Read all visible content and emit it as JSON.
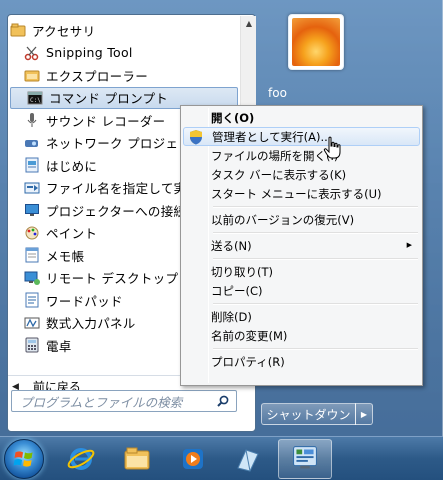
{
  "start_menu": {
    "programs": [
      {
        "label": "アクセサリ",
        "icon": "folder-icon",
        "folder": true
      },
      {
        "label": "Snipping Tool",
        "icon": "scissors-icon"
      },
      {
        "label": "エクスプローラー",
        "icon": "explorer-icon"
      },
      {
        "label": "コマンド プロンプト",
        "icon": "cmd-icon",
        "selected": true
      },
      {
        "label": "サウンド レコーダー",
        "icon": "microphone-icon"
      },
      {
        "label": "ネットワーク プロジェ",
        "icon": "network-projector-icon"
      },
      {
        "label": "はじめに",
        "icon": "getting-started-icon"
      },
      {
        "label": "ファイル名を指定して実",
        "icon": "run-icon"
      },
      {
        "label": "プロジェクターへの接続",
        "icon": "projector-icon"
      },
      {
        "label": "ペイント",
        "icon": "paint-icon"
      },
      {
        "label": "メモ帳",
        "icon": "notepad-icon"
      },
      {
        "label": "リモート デスクトップ",
        "icon": "remote-desktop-icon"
      },
      {
        "label": "ワードパッド",
        "icon": "wordpad-icon"
      },
      {
        "label": "数式入力パネル",
        "icon": "math-input-icon"
      },
      {
        "label": "電卓",
        "icon": "calculator-icon"
      }
    ],
    "back_label": "前に戻る",
    "search_placeholder": "プログラムとファイルの検索",
    "user_name": "foo",
    "shutdown_label": "シャットダウン"
  },
  "context_menu": {
    "items": [
      {
        "label": "開く(O)",
        "bold": true
      },
      {
        "label": "管理者として実行(A)...",
        "icon": "uac-shield-icon",
        "hover": true
      },
      {
        "label": "ファイルの場所を開く(I)"
      },
      {
        "label": "タスク バーに表示する(K)"
      },
      {
        "label": "スタート メニューに表示する(U)"
      },
      {
        "separator": true
      },
      {
        "label": "以前のバージョンの復元(V)"
      },
      {
        "separator": true
      },
      {
        "label": "送る(N)",
        "submenu": true
      },
      {
        "separator": true
      },
      {
        "label": "切り取り(T)"
      },
      {
        "label": "コピー(C)"
      },
      {
        "separator": true
      },
      {
        "label": "削除(D)"
      },
      {
        "label": "名前の変更(M)"
      },
      {
        "separator": true
      },
      {
        "label": "プロパティ(R)"
      }
    ]
  },
  "colors": {
    "selection": "#c9daee",
    "menu_bg": "#f5f6f7",
    "hover_border": "#aecff7",
    "taskbar": "#2d5a88"
  }
}
